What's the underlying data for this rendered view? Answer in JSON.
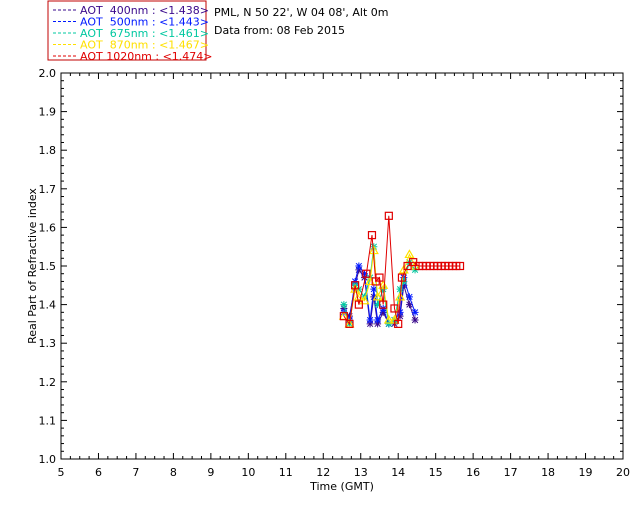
{
  "chart_data": {
    "type": "line",
    "title": "",
    "xlabel": "Time (GMT)",
    "ylabel": "Real Part of Refractive index",
    "xlim": [
      5,
      20
    ],
    "ylim": [
      1.0,
      2.0
    ],
    "xticks": [
      "5",
      "6",
      "7",
      "8",
      "9",
      "10",
      "11",
      "12",
      "13",
      "14",
      "15",
      "16",
      "17",
      "18",
      "19",
      "20"
    ],
    "yticks": [
      "1.0",
      "1.1",
      "1.2",
      "1.3",
      "1.4",
      "1.5",
      "1.6",
      "1.7",
      "1.8",
      "1.9",
      "2.0"
    ],
    "legend_position": "top-left, outside plot",
    "info_lines": [
      "PML, N 50 22', W 04 08', Alt 0m",
      "Data from: 08 Feb 2015"
    ],
    "grid": false,
    "series": [
      {
        "name": "AOT  400nm : <1.438>",
        "color": "#3a0a8c",
        "marker": "star",
        "x": [
          12.55,
          12.7,
          12.85,
          12.95,
          13.1,
          13.25,
          13.35,
          13.45,
          13.6,
          13.75,
          13.9,
          14.05,
          14.15,
          14.3,
          14.45
        ],
        "y": [
          1.39,
          1.37,
          1.45,
          1.49,
          1.47,
          1.35,
          1.42,
          1.35,
          1.38,
          1.35,
          1.35,
          1.37,
          1.45,
          1.4,
          1.36
        ]
      },
      {
        "name": "AOT  500nm : <1.443>",
        "color": "#0018ff",
        "marker": "star",
        "x": [
          12.55,
          12.7,
          12.85,
          12.95,
          13.1,
          13.25,
          13.35,
          13.45,
          13.6,
          13.75,
          13.9,
          14.05,
          14.15,
          14.3,
          14.45
        ],
        "y": [
          1.38,
          1.36,
          1.46,
          1.5,
          1.48,
          1.36,
          1.44,
          1.36,
          1.39,
          1.35,
          1.36,
          1.38,
          1.47,
          1.42,
          1.38
        ]
      },
      {
        "name": "AOT  675nm : <1.461>",
        "color": "#00c8a0",
        "marker": "star",
        "x": [
          12.55,
          12.7,
          12.85,
          12.95,
          13.1,
          13.25,
          13.35,
          13.45,
          13.6,
          13.75,
          13.9,
          14.05,
          14.15,
          14.3,
          14.45
        ],
        "y": [
          1.4,
          1.35,
          1.45,
          1.44,
          1.42,
          1.47,
          1.55,
          1.4,
          1.44,
          1.35,
          1.36,
          1.44,
          1.46,
          1.51,
          1.49
        ]
      },
      {
        "name": "AOT  870nm : <1.467>",
        "color": "#ffe000",
        "marker": "triangle",
        "x": [
          12.55,
          12.7,
          12.85,
          12.95,
          13.1,
          13.25,
          13.35,
          13.45,
          13.6,
          13.75,
          13.9,
          14.05,
          14.15,
          14.3,
          14.45
        ],
        "y": [
          1.37,
          1.35,
          1.44,
          1.42,
          1.41,
          1.46,
          1.54,
          1.42,
          1.45,
          1.36,
          1.36,
          1.42,
          1.49,
          1.53,
          1.5
        ]
      },
      {
        "name": "AOT 1020nm : <1.474>",
        "color": "#e00000",
        "marker": "square",
        "x": [
          12.55,
          12.7,
          12.85,
          12.95,
          13.15,
          13.3,
          13.4,
          13.5,
          13.6,
          13.75,
          13.9,
          14.0,
          14.1,
          14.25,
          14.4,
          14.55,
          14.65,
          14.75,
          14.85,
          14.95,
          15.05,
          15.15,
          15.25,
          15.35,
          15.45,
          15.55,
          15.65
        ],
        "y": [
          1.37,
          1.35,
          1.45,
          1.4,
          1.48,
          1.58,
          1.46,
          1.47,
          1.4,
          1.63,
          1.39,
          1.35,
          1.47,
          1.5,
          1.51,
          1.5,
          1.5,
          1.5,
          1.5,
          1.5,
          1.5,
          1.5,
          1.5,
          1.5,
          1.5,
          1.5,
          1.5
        ]
      }
    ]
  }
}
